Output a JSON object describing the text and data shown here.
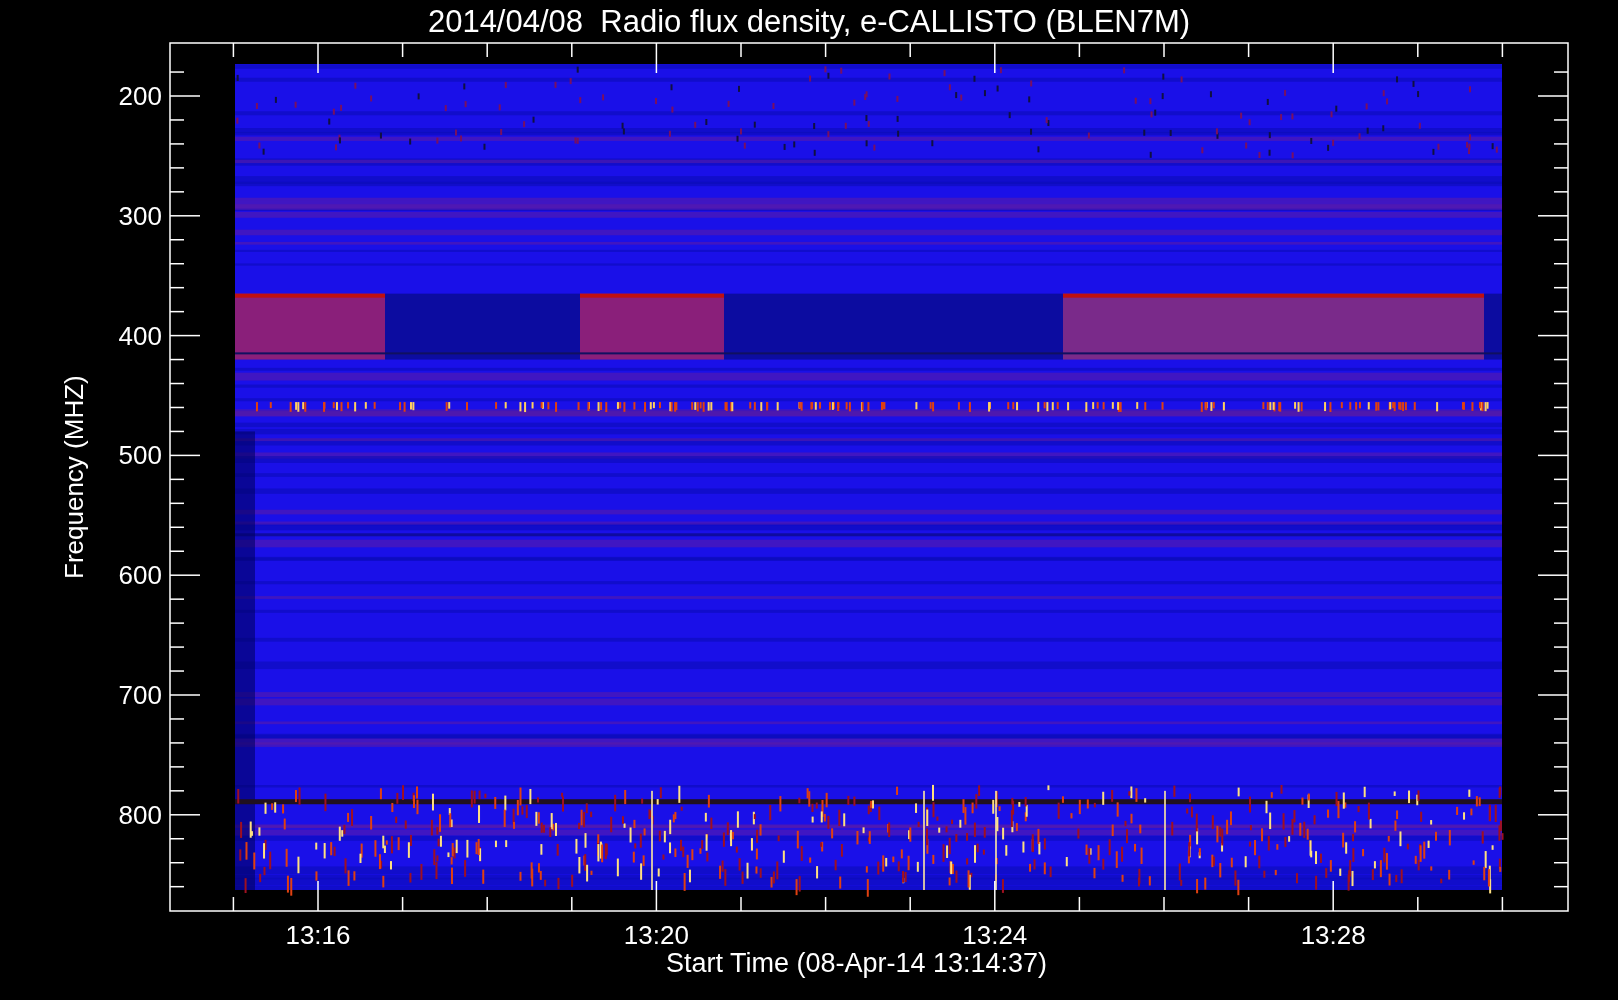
{
  "title": "2014/04/08  Radio flux density, e-CALLISTO (BLEN7M)",
  "y_axis": {
    "label": "Frequency (MHZ)",
    "ticks": [
      "200",
      "300",
      "400",
      "500",
      "600",
      "700",
      "800"
    ]
  },
  "x_axis": {
    "label": "Start Time (08-Apr-14 13:14:37)",
    "ticks": [
      "13:16",
      "13:20",
      "13:24",
      "13:28"
    ]
  }
}
